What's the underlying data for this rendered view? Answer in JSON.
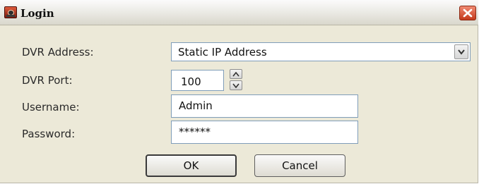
{
  "window": {
    "title": "Login",
    "close_glyph": "close-icon"
  },
  "form": {
    "dvr_address": {
      "label": "DVR Address:",
      "value": "Static IP Address"
    },
    "dvr_port": {
      "label": "DVR Port:",
      "value": "100"
    },
    "username": {
      "label": "Username:",
      "value": "Admin"
    },
    "password": {
      "label": "Password:",
      "value": "******"
    }
  },
  "buttons": {
    "ok": "OK",
    "cancel": "Cancel"
  },
  "colors": {
    "close_button": "#d9492a",
    "field_border": "#7f9db9",
    "window_bg": "#ece9d8"
  }
}
